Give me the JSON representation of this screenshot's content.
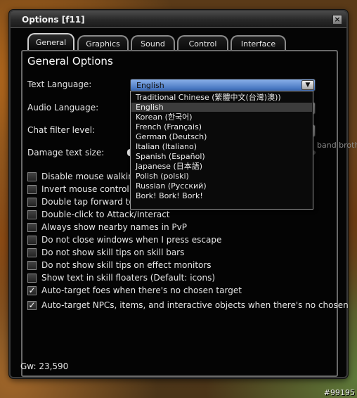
{
  "window": {
    "title": "Options  [f11]",
    "close_label": "×"
  },
  "tabs": [
    {
      "label": "General",
      "active": true
    },
    {
      "label": "Graphics",
      "active": false
    },
    {
      "label": "Sound",
      "active": false
    },
    {
      "label": "Control",
      "active": false
    },
    {
      "label": "Interface",
      "active": false
    }
  ],
  "panel": {
    "heading": "General Options",
    "text_language_label": "Text Language:",
    "text_language_value": "English",
    "audio_language_label": "Audio Language:",
    "chat_filter_label": "Chat filter level:",
    "damage_text_label": "Damage text size:",
    "partial_offscreen_text": "band broth"
  },
  "dropdown": {
    "options": [
      "Traditional Chinese (繁體中文(台灣)澳))",
      "English",
      "Korean (한국어)",
      "French (Français)",
      "German (Deutsch)",
      "Italian (Italiano)",
      "Spanish (Español)",
      "Japanese (日本語)",
      "Polish (polski)",
      "Russian (Русский)",
      "Bork! Bork! Bork!"
    ],
    "selected_index": 1
  },
  "checkboxes": [
    {
      "label": "Disable mouse walking",
      "checked": false
    },
    {
      "label": "Invert mouse control of",
      "checked": false
    },
    {
      "label": "Double tap forward to auto-run, backward to flip",
      "checked": false
    },
    {
      "label": "Double-click to Attack/Interact",
      "checked": false
    },
    {
      "label": "Always show nearby names in PvP",
      "checked": false
    },
    {
      "label": "Do not close windows when I press escape",
      "checked": false
    },
    {
      "label": "Do not show skill tips on skill bars",
      "checked": false
    },
    {
      "label": "Do not show skill tips on effect monitors",
      "checked": false
    },
    {
      "label": "Show text in skill floaters (Default: icons)",
      "checked": false
    },
    {
      "label": "Auto-target foes when there's no chosen target",
      "checked": true
    },
    {
      "label": "Auto-target NPCs, items, and interactive objects when there's no chosen",
      "checked": true
    }
  ],
  "footer": {
    "gold": "Gw: 23,590"
  },
  "watermark": "#99195",
  "colors": {
    "window_bg": "#050505",
    "select_open": "#3a6ab8",
    "text": "#e6e6e6"
  }
}
